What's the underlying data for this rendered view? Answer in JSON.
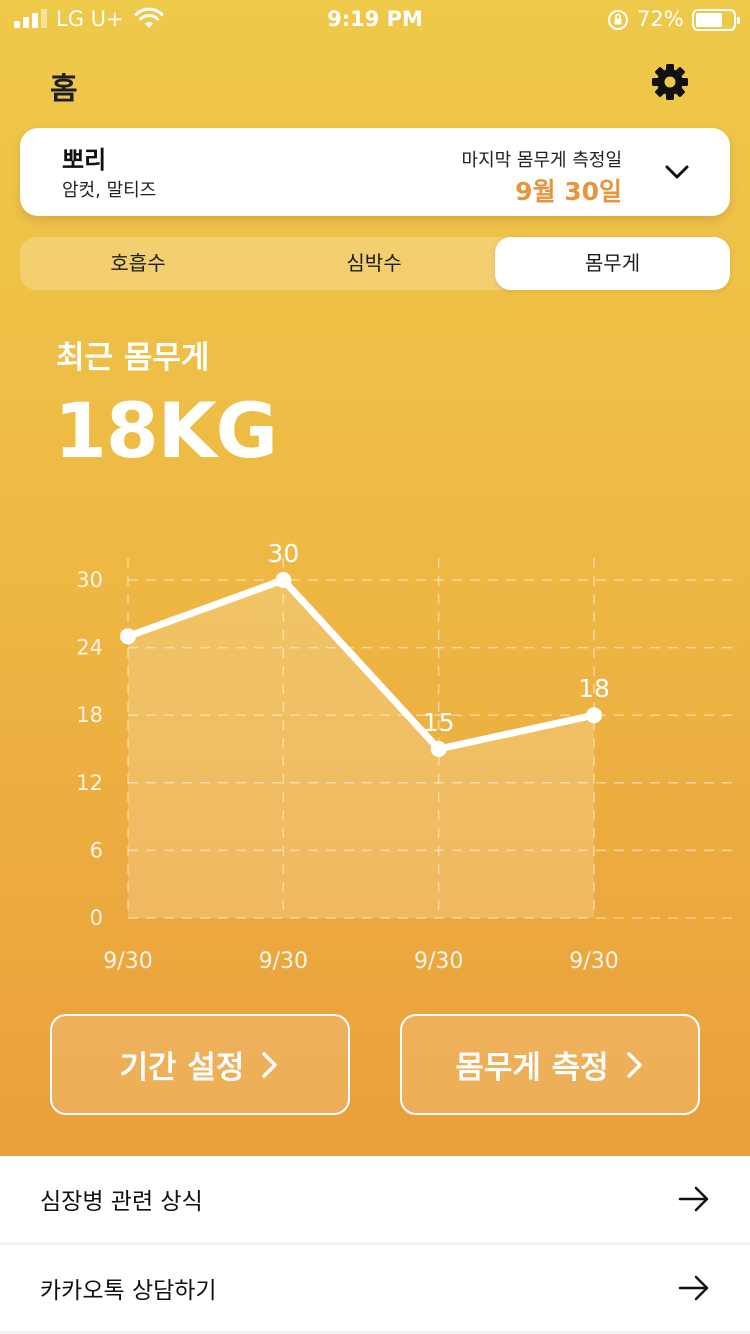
{
  "status_bar": {
    "carrier": "LG U+",
    "time": "9:19 PM",
    "battery_percent": "72%",
    "battery_level": 0.72,
    "icons": [
      "signal-icon",
      "wifi-icon",
      "rotation-lock-icon",
      "battery-icon"
    ]
  },
  "header": {
    "title": "홈",
    "settings_icon": "gear-icon"
  },
  "pet": {
    "name": "뽀리",
    "breed": "암컷, 말티즈",
    "last_weight_label": "마지막 몸무게 측정일",
    "last_weight_date": "9월 30일",
    "dropdown_icon": "chevron-down-icon"
  },
  "tabs": [
    {
      "label": "호흡수",
      "selected": false
    },
    {
      "label": "심박수",
      "selected": false
    },
    {
      "label": "몸무게",
      "selected": true
    }
  ],
  "summary": {
    "label": "최근 몸무게",
    "value": "18KG"
  },
  "chart_data": {
    "type": "line",
    "categories": [
      "9/30",
      "9/30",
      "9/30",
      "9/30"
    ],
    "values": [
      25,
      30,
      15,
      18
    ],
    "data_labels": [
      "",
      "30",
      "15",
      "18"
    ],
    "y_ticks": [
      "30",
      "24",
      "18",
      "12",
      "6",
      "0"
    ],
    "ylim": [
      0,
      30
    ],
    "grid": true,
    "area_fill": true,
    "colors": {
      "line": "#ffffff",
      "area": "rgba(255,255,255,0.18)",
      "grid": "rgba(255,255,255,0.45)"
    }
  },
  "actions": {
    "period_button": "기간 설정",
    "measure_button": "몸무게 측정"
  },
  "menu": [
    {
      "label": "심장병 관련 상식"
    },
    {
      "label": "카카오톡 상담하기"
    }
  ],
  "colors": {
    "gradient_top": "#efc94a",
    "gradient_bottom": "#eb9e3c",
    "accent": "#e8943a"
  }
}
